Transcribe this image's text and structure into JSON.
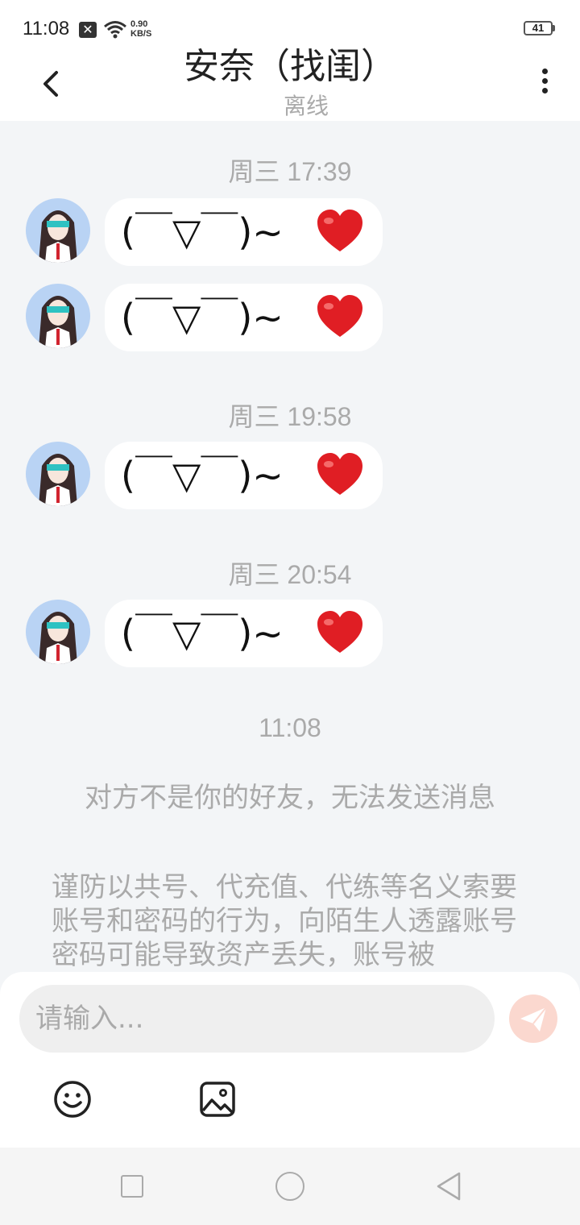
{
  "status_bar": {
    "time": "11:08",
    "notification_x": "✕",
    "net_speed_value": "0.90",
    "net_speed_unit": "KB/S",
    "battery": "41"
  },
  "header": {
    "title": "安奈（找闺）",
    "subtitle": "离线"
  },
  "messages": [
    {
      "timestamp": "周三 17:39",
      "kaomoji": "(￣▽￣)~",
      "emoji": "heart"
    },
    {
      "kaomoji": "(￣▽￣)~",
      "emoji": "heart"
    },
    {
      "timestamp": "周三 19:58",
      "kaomoji": "(￣▽￣)~",
      "emoji": "heart"
    },
    {
      "timestamp": "周三 20:54",
      "kaomoji": "(￣▽￣)~",
      "emoji": "heart"
    }
  ],
  "system": {
    "time": "11:08",
    "notice": "对方不是你的好友，无法发送消息",
    "warning": "谨防以共号、代充值、代练等名义索要账号和密码的行为，向陌生人透露账号密码可能导致资产丢失，账号被"
  },
  "input": {
    "placeholder": "请输入..."
  },
  "colors": {
    "background": "#f3f5f7",
    "bubble": "#ffffff",
    "send_accent": "#f4a08c",
    "muted_text": "#aaaaaa"
  },
  "icons": [
    "back-arrow-icon",
    "more-vertical-icon",
    "send-plane-icon",
    "smiley-icon",
    "image-icon",
    "heart-icon"
  ]
}
